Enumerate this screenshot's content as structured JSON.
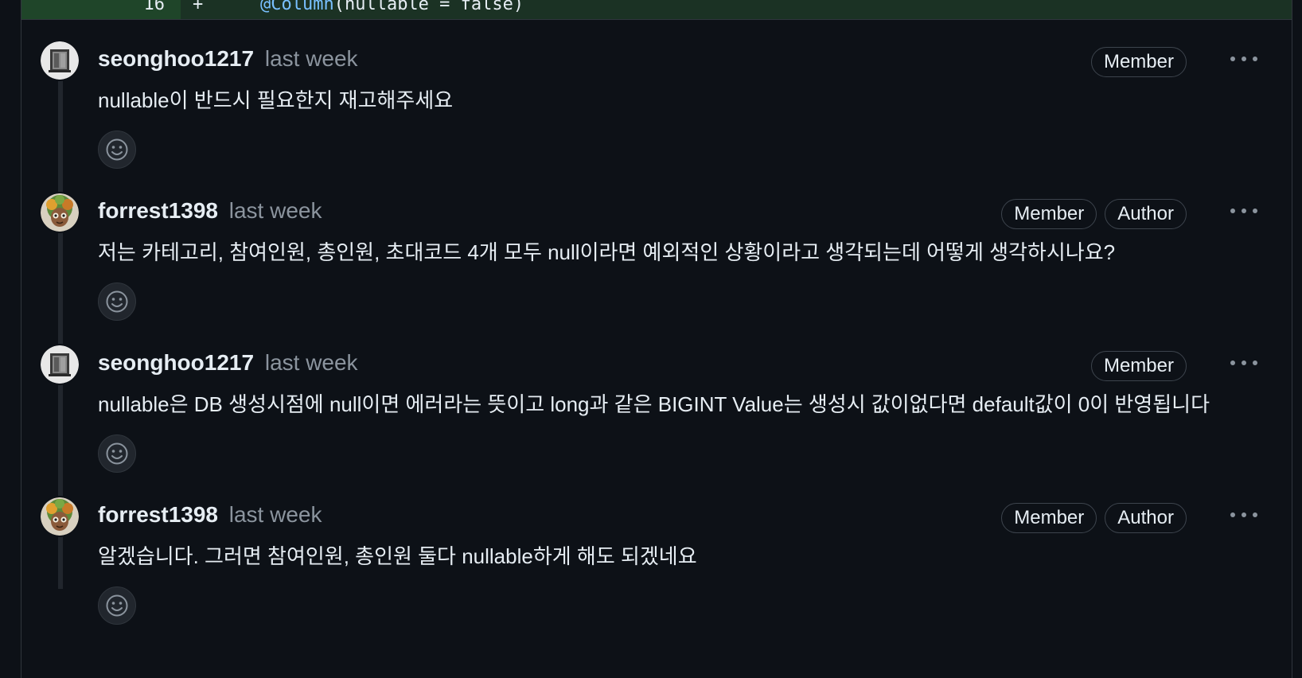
{
  "diff": {
    "line_number": "16",
    "sign": "+",
    "code_annotation": "@Column",
    "code_rest": "(nullable = false)"
  },
  "comments": [
    {
      "author": "seonghoo1217",
      "time": "last week",
      "badges": [
        "Member"
      ],
      "body": "nullable이 반드시 필요한지 재고해주세요",
      "avatar": "seonghoo-avatar"
    },
    {
      "author": "forrest1398",
      "time": "last week",
      "badges": [
        "Member",
        "Author"
      ],
      "body": "저는 카테고리, 참여인원, 총인원, 초대코드 4개 모두 null이라면 예외적인 상황이라고 생각되는데 어떻게 생각하시나요?",
      "avatar": "forrest-avatar"
    },
    {
      "author": "seonghoo1217",
      "time": "last week",
      "badges": [
        "Member"
      ],
      "body": "nullable은 DB 생성시점에 null이면 에러라는 뜻이고 long과 같은 BIGINT Value는 생성시 값이없다면 default값이 0이 반영됩니다",
      "avatar": "seonghoo-avatar"
    },
    {
      "author": "forrest1398",
      "time": "last week",
      "badges": [
        "Member",
        "Author"
      ],
      "body": "알겠습니다. 그러면 참여인원, 총인원 둘다 nullable하게 해도 되겠네요",
      "avatar": "forrest-avatar"
    }
  ],
  "icons": {
    "more": "kebab-horizontal-icon",
    "reaction": "smiley-icon"
  },
  "colors": {
    "background": "#0d1117",
    "border": "#30363d",
    "muted_text": "#8b949e",
    "text": "#e6edf3",
    "diff_added_bg": "#1b3224"
  }
}
